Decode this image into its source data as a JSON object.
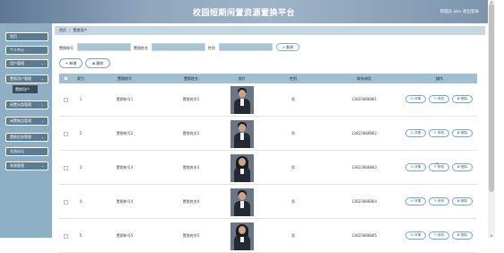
{
  "header": {
    "title": "校园短期闲置资源置换平台",
    "user": "管理员 abo",
    "logout": "退出登录"
  },
  "sidebar": {
    "items": [
      {
        "label": "首页",
        "arrow": ""
      },
      {
        "label": "个人中心",
        "arrow": ""
      },
      {
        "label": "用户管理",
        "arrow": "⌄"
      },
      {
        "label": "置换用户管理",
        "arrow": "⌄"
      },
      {
        "label": "闲置分类管理",
        "arrow": "⌄"
      },
      {
        "label": "闲置物品管理",
        "arrow": "⌄"
      },
      {
        "label": "置换信息管理",
        "arrow": "⌄"
      },
      {
        "label": "交流论坛",
        "arrow": ""
      },
      {
        "label": "系统管理",
        "arrow": "⌄"
      }
    ],
    "active_sub": "置换用户"
  },
  "breadcrumb": {
    "home": "首页",
    "current": "置换用户"
  },
  "search": {
    "field1_label": "置换帐号",
    "field2_label": "置换姓名",
    "field3_label": "性别",
    "button": "查询"
  },
  "actions": {
    "add": "新增",
    "delete": "删除"
  },
  "table": {
    "headers": [
      "索引",
      "置换帐号",
      "置换姓名",
      "照片",
      "性别",
      "联系电话",
      "操作"
    ],
    "rows": [
      {
        "index": "1",
        "account": "置换帐号1",
        "name": "置换姓名1",
        "gender": "男",
        "phone": "13823888881"
      },
      {
        "index": "2",
        "account": "置换帐号2",
        "name": "置换姓名2",
        "gender": "男",
        "phone": "13823888882"
      },
      {
        "index": "3",
        "account": "置换帐号3",
        "name": "置换姓名3",
        "gender": "男",
        "phone": "13823888883"
      },
      {
        "index": "4",
        "account": "置换帐号4",
        "name": "置换姓名4",
        "gender": "男",
        "phone": "13823888884"
      },
      {
        "index": "5",
        "account": "置换帐号5",
        "name": "置换姓名5",
        "gender": "男",
        "phone": "13823888885"
      }
    ],
    "ops": {
      "detail": "详情",
      "edit": "修改",
      "delete": "删除"
    }
  }
}
